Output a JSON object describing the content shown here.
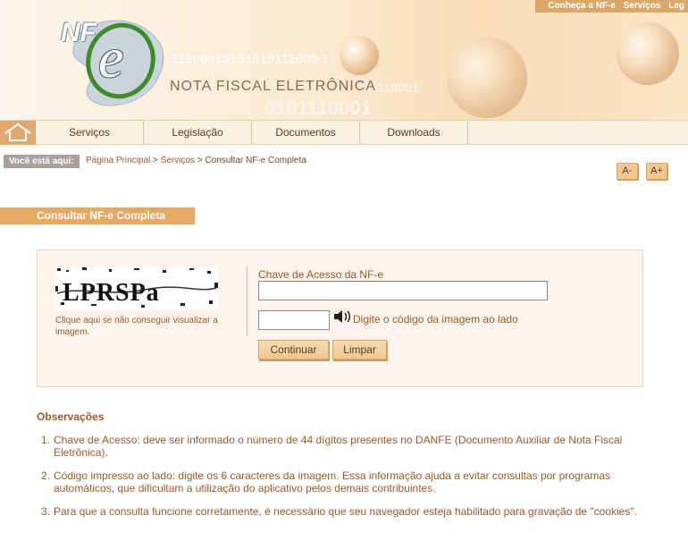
{
  "top_links": [
    "Conheça a NF-e",
    "Serviços",
    "Leg"
  ],
  "header": {
    "logo_text": "NF",
    "logo_e": "e",
    "title": "NOTA FISCAL ELETRÔNICA",
    "binary_1": "11100010101010111000 1",
    "binary_2": "0101110001",
    "binary_3": "01110001"
  },
  "nav": {
    "items": [
      "Serviços",
      "Legislação",
      "Documentos",
      "Downloads"
    ]
  },
  "breadcrumb": {
    "label": "Você está aqui:",
    "home": "Página Principal",
    "sep1": " > ",
    "services": "Serviços",
    "sep2": " > ",
    "current": "Consultar NF-e Completa"
  },
  "font_controls": {
    "decrease": "A-",
    "increase": "A+"
  },
  "section_title": "Consultar NF-e Completa",
  "form": {
    "captcha_text": "LPRSPa",
    "captcha_help": "Clique aqui se não conseguir visualizar a imagem.",
    "key_label": "Chave de Acesso da NF-e",
    "key_value": "",
    "code_value": "",
    "code_label": "Digite o código da imagem ao lado",
    "continue_label": "Continuar",
    "clear_label": "Limpar"
  },
  "observations": {
    "title": "Observações",
    "items": [
      {
        "num": "1.",
        "text": "Chave de Acesso: deve ser informado o número de 44 dígitos presentes no DANFE (Documento Auxiliar de Nota Fiscal Eletrônica)."
      },
      {
        "num": "2.",
        "text": "Código impresso ao lado: digite os 6 caracteres da imagem. Essa informação ajuda a evitar consultas por programas automáticos, que dificultam a utilização do aplicativo pelos demais contribuintes."
      },
      {
        "num": "3.",
        "text": "Para que a consulta funcione corretamente, é necessário que seu navegador esteja habilitado para gravação de \"cookies\"."
      }
    ]
  },
  "colors": {
    "accent": "#e5a965",
    "text": "#9a5a2a",
    "panel": "#fdf5ec"
  }
}
